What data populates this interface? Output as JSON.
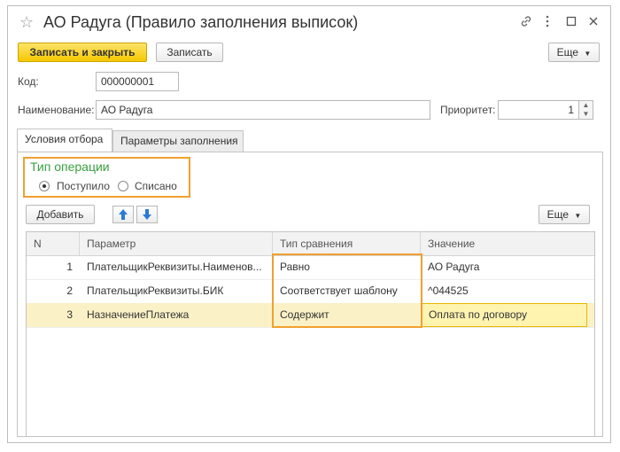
{
  "window": {
    "title": "АО Радуга (Правило заполнения выписок)",
    "controls": [
      "link-icon",
      "more-icon",
      "maximize-icon",
      "close-icon"
    ]
  },
  "toolbar": {
    "save_close_label": "Записать и закрыть",
    "save_label": "Записать",
    "more_label": "Еще"
  },
  "form": {
    "code_label": "Код:",
    "code_value": "000000001",
    "name_label": "Наименование:",
    "name_value": "АО Радуга",
    "priority_label": "Приоритет:",
    "priority_value": "1"
  },
  "tabs": [
    {
      "label": "Условия отбора",
      "active": true
    },
    {
      "label": "Параметры заполнения",
      "active": false
    }
  ],
  "operation": {
    "title": "Тип операции",
    "options": [
      {
        "label": "Поступило",
        "selected": true
      },
      {
        "label": "Списано",
        "selected": false
      }
    ]
  },
  "grid_toolbar": {
    "add_label": "Добавить",
    "more_label": "Еще"
  },
  "table": {
    "columns": [
      "N",
      "Параметр",
      "Тип сравнения",
      "Значение"
    ],
    "rows": [
      {
        "n": "1",
        "param": "ПлательщикРеквизиты.Наименов...",
        "compare": "Равно",
        "value": "АО Радуга"
      },
      {
        "n": "2",
        "param": "ПлательщикРеквизиты.БИК",
        "compare": "Соответствует шаблону",
        "value": "^044525"
      },
      {
        "n": "3",
        "param": "НазначениеПлатежа",
        "compare": "Содержит",
        "value": "Оплата по договору"
      }
    ],
    "selected_row": 3
  },
  "colors": {
    "accent_yellow": "#f5c800",
    "highlight_orange": "#f0a030",
    "group_green": "#3aa041",
    "selected_row": "#fbf1c6"
  }
}
